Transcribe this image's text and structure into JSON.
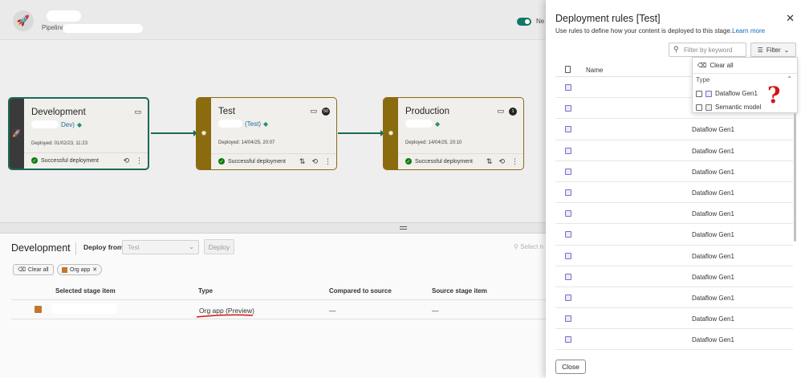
{
  "header": {
    "pipeline_label": "Pipeline",
    "toggle_label": "Ne"
  },
  "stages": [
    {
      "title": "Development",
      "sub_suffix": "Dev)",
      "deployed": "Deployed: 01/02/23, 11:23",
      "status": "Successful deployment",
      "badge": ""
    },
    {
      "title": "Test",
      "sub_suffix": "(Test)",
      "deployed": "Deployed: 14/04/25, 20:07",
      "status": "Successful deployment",
      "badge": "50"
    },
    {
      "title": "Production",
      "sub_suffix": "",
      "deployed": "Deployed: 14/04/25, 20:10",
      "status": "Successful deployment",
      "badge": "1"
    }
  ],
  "bottom": {
    "title": "Development",
    "deploy_from_label": "Deploy from",
    "deploy_from_value": "Test",
    "deploy_button": "Deploy",
    "select_link": "Select n",
    "chips": {
      "clear_all": "Clear all",
      "org_app": "Org app"
    },
    "columns": [
      "Selected stage item",
      "Type",
      "Compared to source",
      "Source stage item"
    ],
    "row": {
      "type": "Org app (Preview)",
      "compared": "—",
      "source": "—"
    }
  },
  "panel": {
    "title": "Deployment rules [Test]",
    "description": "Use rules to define how your content is deployed to this stage.",
    "learn_more": "Learn more",
    "search_placeholder": "Filter by keyword",
    "filter_label": "Filter",
    "name_header": "Name",
    "close_button": "Close",
    "rows": [
      {
        "name": "",
        "type": ""
      },
      {
        "name": "",
        "type": ""
      },
      {
        "name": "",
        "type": "Dataflow Gen1"
      },
      {
        "name": "",
        "type": "Dataflow Gen1"
      },
      {
        "name": "",
        "type": "Dataflow Gen1"
      },
      {
        "name": "",
        "type": "Dataflow Gen1"
      },
      {
        "name": "",
        "type": "Dataflow Gen1"
      },
      {
        "name": "",
        "type": "Dataflow Gen1"
      },
      {
        "name": "",
        "type": "Dataflow Gen1"
      },
      {
        "name": "",
        "type": "Dataflow Gen1"
      },
      {
        "name": "",
        "type": "Dataflow Gen1"
      },
      {
        "name": "",
        "type": "Dataflow Gen1"
      },
      {
        "name": "",
        "type": "Dataflow Gen1"
      }
    ]
  },
  "filter_dropdown": {
    "clear_all": "Clear all",
    "group_label": "Type",
    "options": [
      "Dataflow Gen1",
      "Semantic model"
    ]
  },
  "annotation": {
    "mark": "?"
  },
  "colors": {
    "accent_green": "#1b6a57",
    "stage_gold": "#8a6b0d",
    "link_blue": "#0f6cbd",
    "annotation_red": "#d41414"
  }
}
